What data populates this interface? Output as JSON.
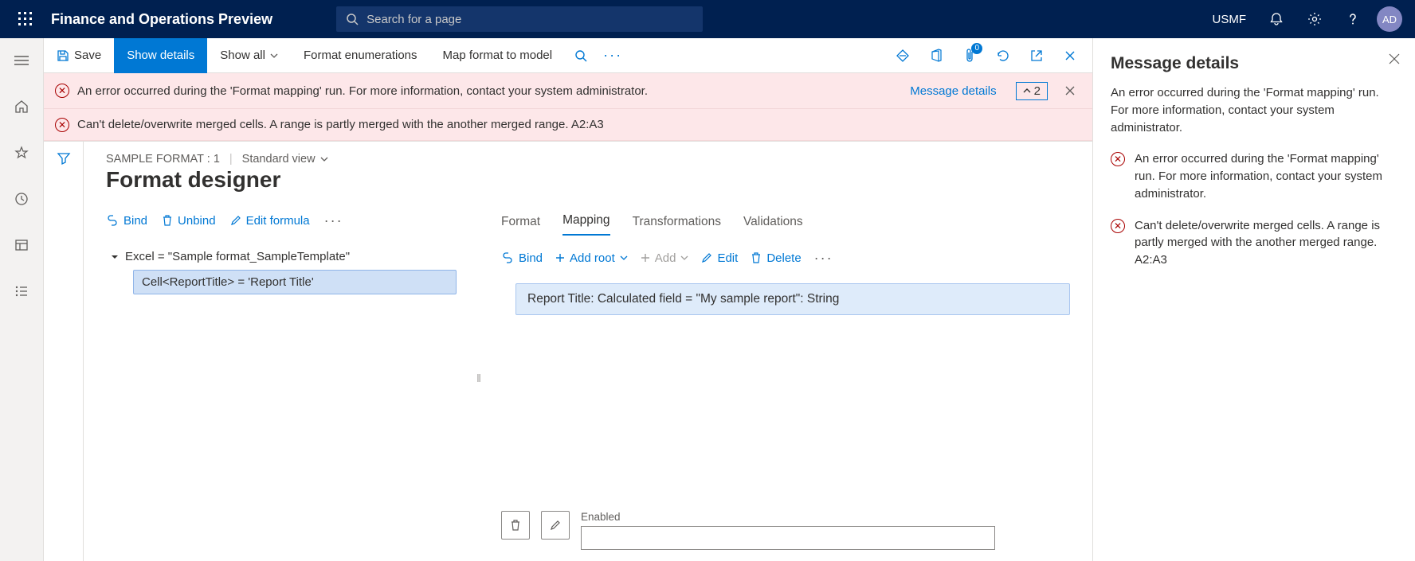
{
  "header": {
    "app_title": "Finance and Operations Preview",
    "search_placeholder": "Search for a page",
    "company": "USMF",
    "avatar": "AD"
  },
  "action_bar": {
    "save": "Save",
    "show_details": "Show details",
    "show_all": "Show all",
    "format_enumerations": "Format enumerations",
    "map_format": "Map format to model",
    "attach_badge": "0"
  },
  "messages": {
    "m1": "An error occurred during the 'Format mapping' run. For more information, contact your system administrator.",
    "m2": "Can't delete/overwrite merged cells. A range is partly merged with the another merged range. A2:A3",
    "details_link": "Message details",
    "count": "2"
  },
  "page": {
    "breadcrumb": "SAMPLE FORMAT : 1",
    "view": "Standard view",
    "title": "Format designer"
  },
  "left_pane": {
    "bind": "Bind",
    "unbind": "Unbind",
    "edit_formula": "Edit formula",
    "tree_root": "Excel = \"Sample format_SampleTemplate\"",
    "tree_child": "Cell<ReportTitle> = 'Report Title'"
  },
  "tabs": {
    "format": "Format",
    "mapping": "Mapping",
    "transformations": "Transformations",
    "validations": "Validations"
  },
  "right_pane": {
    "bind": "Bind",
    "add_root": "Add root",
    "add": "Add",
    "edit": "Edit",
    "delete": "Delete",
    "item": "Report Title: Calculated field = \"My sample report\": String",
    "enabled_label": "Enabled"
  },
  "panel": {
    "title": "Message details",
    "desc": "An error occurred during the 'Format mapping' run. For more information, contact your system administrator.",
    "item1": "An error occurred during the 'Format mapping' run. For more information, contact your system administrator.",
    "item2": "Can't delete/overwrite merged cells. A range is partly merged with the another merged range. A2:A3"
  }
}
